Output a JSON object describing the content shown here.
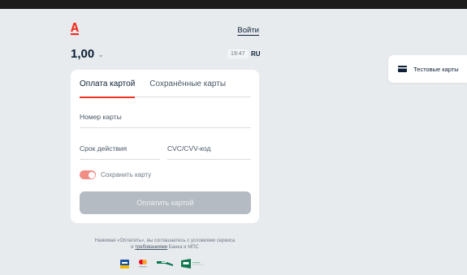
{
  "header": {
    "login_label": "Войти"
  },
  "payment": {
    "amount": "1,00",
    "time": "19:47",
    "language": "RU"
  },
  "card_form": {
    "tabs": [
      {
        "label": "Оплата картой",
        "active": true
      },
      {
        "label": "Сохранённые карты",
        "active": false
      }
    ],
    "card_number_placeholder": "Номер карты",
    "expiry_placeholder": "Срок действия",
    "cvc_placeholder": "CVC/CVV-код",
    "save_card_label": "Сохранить карту",
    "save_card_enabled": true,
    "pay_button_label": "Оплатить картой"
  },
  "footer": {
    "terms_text_1": "Нажимая «Оплатить», вы соглашаетесь с условиями сервиса",
    "terms_text_2": "и",
    "terms_link": "требованиями",
    "terms_text_3": "Банка и МПС",
    "badges": [
      "visa-icon",
      "mastercard-icon",
      "mir-icon",
      "pci-dss-icon"
    ]
  },
  "side_panel": {
    "test_cards_label": "Тестовые карты"
  },
  "colors": {
    "accent": "#ef3124",
    "background": "#e8ebee",
    "button_disabled": "#b4bbc2",
    "toggle_on": "#f08e86"
  }
}
